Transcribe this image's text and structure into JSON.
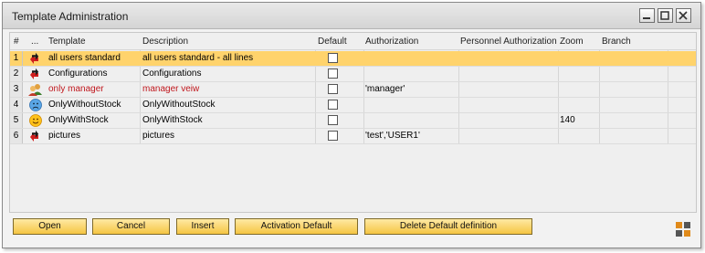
{
  "window": {
    "title": "Template Administration"
  },
  "columns": {
    "num": "#",
    "more": "...",
    "template": "Template",
    "description": "Description",
    "default": "Default",
    "authorization": "Authorization",
    "personnel_authorization": "Personnel Authorization",
    "zoom": "Zoom",
    "branch": "Branch"
  },
  "rows": [
    {
      "num": "1",
      "icon": "red-arrows-icon",
      "template": "all users standard",
      "description": "all users standard - all lines",
      "default": false,
      "authorization": "",
      "zoom": "",
      "selected": true
    },
    {
      "num": "2",
      "icon": "red-arrows-icon",
      "template": "Configurations",
      "description": "Configurations",
      "default": false,
      "authorization": "",
      "zoom": ""
    },
    {
      "num": "3",
      "icon": "users-icon",
      "template": "only manager",
      "description": "manager veiw",
      "default": false,
      "authorization": "'manager'",
      "zoom": "",
      "highlight_color": "#c0171d"
    },
    {
      "num": "4",
      "icon": "blue-face-icon",
      "template": "OnlyWithoutStock",
      "description": "OnlyWithoutStock",
      "default": false,
      "authorization": "",
      "zoom": ""
    },
    {
      "num": "5",
      "icon": "smiley-icon",
      "template": "OnlyWithStock",
      "description": "OnlyWithStock",
      "default": false,
      "authorization": "",
      "zoom": "140"
    },
    {
      "num": "6",
      "icon": "red-arrows-icon",
      "template": "pictures",
      "description": "pictures",
      "default": false,
      "authorization": "'test','USER1'",
      "zoom": ""
    }
  ],
  "buttons": {
    "open": "Open",
    "cancel": "Cancel",
    "insert": "Insert",
    "activation_default": "Activation Default",
    "delete_default": "Delete Default definition"
  },
  "colors": {
    "accent": "#ffd36c",
    "button": "#f5c542",
    "red_text": "#c0171d"
  }
}
